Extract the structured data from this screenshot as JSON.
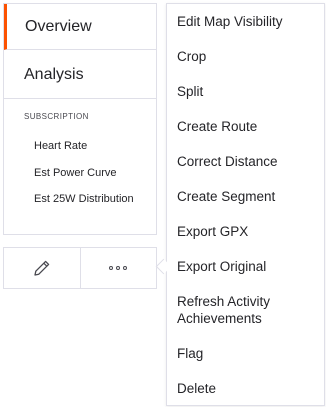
{
  "sidenav": {
    "items": [
      {
        "label": "Overview",
        "active": true
      },
      {
        "label": "Analysis",
        "active": false
      }
    ],
    "subscription_heading": "SUBSCRIPTION",
    "subscription_items": [
      {
        "label": "Heart Rate"
      },
      {
        "label": "Est Power Curve"
      },
      {
        "label": "Est 25W Distribution"
      }
    ]
  },
  "actions": {
    "edit_icon": "pencil-icon",
    "more_icon": "more-dots-icon"
  },
  "menu": {
    "items": [
      {
        "label": "Edit Map Visibility"
      },
      {
        "label": "Crop"
      },
      {
        "label": "Split"
      },
      {
        "label": "Create Route"
      },
      {
        "label": "Correct Distance"
      },
      {
        "label": "Create Segment"
      },
      {
        "label": "Export GPX"
      },
      {
        "label": "Export Original"
      },
      {
        "label": "Refresh Activity Achievements"
      },
      {
        "label": "Flag"
      },
      {
        "label": "Delete"
      }
    ]
  },
  "colors": {
    "accent": "#fc5200",
    "border": "#dfdfe8",
    "text": "#242428"
  }
}
